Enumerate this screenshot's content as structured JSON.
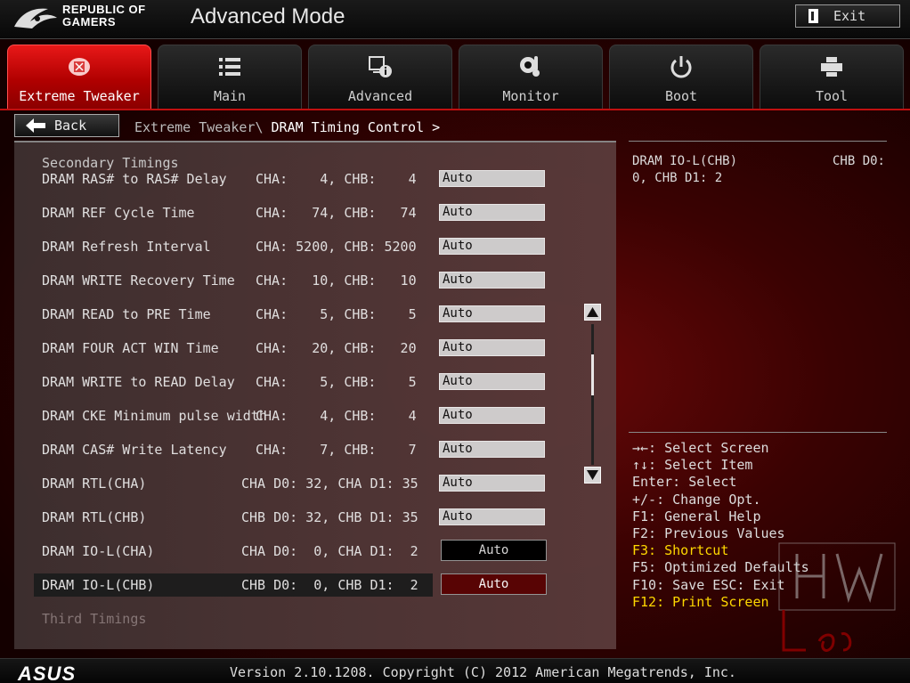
{
  "brand": {
    "line1": "REPUBLIC OF",
    "line2": "GAMERS"
  },
  "header": {
    "title": "Advanced Mode",
    "exit_label": "Exit"
  },
  "tabs": [
    {
      "label": "Extreme Tweaker",
      "icon": "tweaker-icon",
      "active": true
    },
    {
      "label": "Main",
      "icon": "list-icon",
      "active": false
    },
    {
      "label": "Advanced",
      "icon": "info-icon",
      "active": false
    },
    {
      "label": "Monitor",
      "icon": "thermometer-icon",
      "active": false
    },
    {
      "label": "Boot",
      "icon": "power-icon",
      "active": false
    },
    {
      "label": "Tool",
      "icon": "printer-icon",
      "active": false
    }
  ],
  "nav": {
    "back_label": "Back",
    "breadcrumb_parent": "Extreme Tweaker\\",
    "breadcrumb_current": "DRAM Timing Control >"
  },
  "main": {
    "section1": "Secondary Timings",
    "section2": "Third Timings",
    "rows": [
      {
        "label": "DRAM RAS# to RAS# Delay",
        "values": "CHA:    4, CHB:    4",
        "setting": "Auto"
      },
      {
        "label": "DRAM REF Cycle Time",
        "values": "CHA:   74, CHB:   74",
        "setting": "Auto"
      },
      {
        "label": "DRAM Refresh Interval",
        "values": "CHA: 5200, CHB: 5200",
        "setting": "Auto"
      },
      {
        "label": "DRAM WRITE Recovery Time",
        "values": "CHA:   10, CHB:   10",
        "setting": "Auto"
      },
      {
        "label": "DRAM READ to PRE Time",
        "values": "CHA:    5, CHB:    5",
        "setting": "Auto"
      },
      {
        "label": "DRAM FOUR ACT WIN Time",
        "values": "CHA:   20, CHB:   20",
        "setting": "Auto"
      },
      {
        "label": "DRAM WRITE to READ Delay",
        "values": "CHA:    5, CHB:    5",
        "setting": "Auto"
      },
      {
        "label": "DRAM CKE Minimum pulse width",
        "values": "CHA:    4, CHB:    4",
        "setting": "Auto"
      },
      {
        "label": "DRAM CAS# Write Latency",
        "values": "CHA:    7, CHB:    7",
        "setting": "Auto"
      },
      {
        "label": "DRAM RTL(CHA)",
        "values": "CHA D0: 32, CHA D1: 35",
        "setting": "Auto"
      },
      {
        "label": "DRAM RTL(CHB)",
        "values": "CHB D0: 32, CHB D1: 35",
        "setting": "Auto"
      },
      {
        "label": "DRAM IO-L(CHA)",
        "values": "CHA D0:  0, CHA D1:  2",
        "setting": "Auto"
      },
      {
        "label": "DRAM IO-L(CHB)",
        "values": "CHB D0:  0, CHB D1:  2",
        "setting": "Auto"
      }
    ]
  },
  "help": {
    "title": "DRAM IO-L(CHB)",
    "right": "CHB D0:",
    "line2": "0, CHB D1:  2"
  },
  "keys": [
    {
      "text": "→←: Select Screen",
      "highlight": false
    },
    {
      "text": "↑↓: Select Item",
      "highlight": false
    },
    {
      "text": "Enter: Select",
      "highlight": false
    },
    {
      "text": "+/-: Change Opt.",
      "highlight": false
    },
    {
      "text": "F1: General Help",
      "highlight": false
    },
    {
      "text": "F2: Previous Values",
      "highlight": false
    },
    {
      "text": "F3: Shortcut",
      "highlight": true
    },
    {
      "text": "F5: Optimized Defaults",
      "highlight": false
    },
    {
      "text": "F10: Save  ESC: Exit",
      "highlight": false
    },
    {
      "text": "F12: Print Screen",
      "highlight": true
    }
  ],
  "footer": {
    "logo": "ASUS",
    "version": "Version 2.10.1208. Copyright (C) 2012 American Megatrends, Inc."
  },
  "colors": {
    "accent": "#d01010",
    "highlight": "#ffd800",
    "selected_bg": "#5a0505"
  }
}
